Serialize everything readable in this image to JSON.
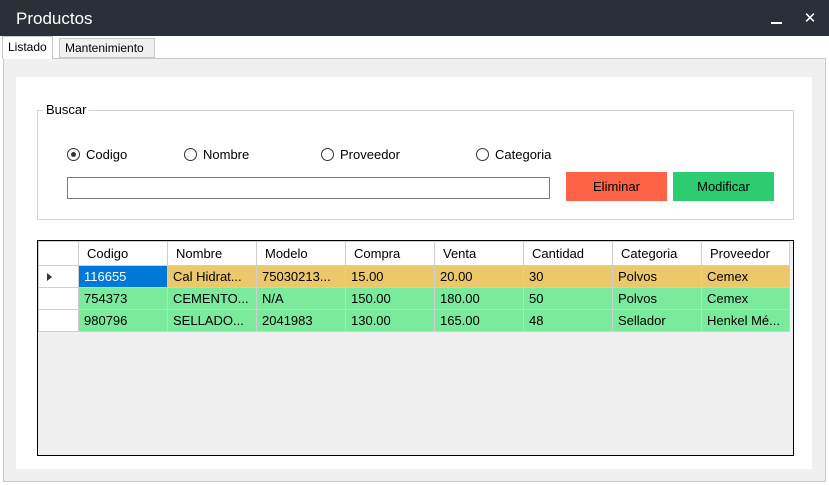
{
  "window": {
    "title": "Productos",
    "minimize_icon": "minimize-icon",
    "close_icon": "close-icon",
    "close_glyph": "✕"
  },
  "tabs": [
    {
      "label": "Listado",
      "active": true
    },
    {
      "label": "Mantenimiento",
      "active": false
    }
  ],
  "search": {
    "group_label": "Buscar",
    "options": [
      {
        "label": "Codigo",
        "checked": true
      },
      {
        "label": "Nombre",
        "checked": false
      },
      {
        "label": "Proveedor",
        "checked": false
      },
      {
        "label": "Categoria",
        "checked": false
      }
    ],
    "value": "",
    "placeholder": ""
  },
  "buttons": {
    "delete_label": "Eliminar",
    "edit_label": "Modificar"
  },
  "table": {
    "columns": [
      "Codigo",
      "Nombre",
      "Modelo",
      "Compra",
      "Venta",
      "Cantidad",
      "Categoria",
      "Proveedor"
    ],
    "rows": [
      {
        "cells": [
          "116655",
          "Cal Hidrat...",
          "75030213...",
          "15.00",
          "20.00",
          "30",
          "Polvos",
          "Cemex"
        ],
        "current": true
      },
      {
        "cells": [
          "754373",
          "CEMENTO...",
          "N/A",
          "150.00",
          "180.00",
          "50",
          "Polvos",
          "Cemex"
        ],
        "current": false
      },
      {
        "cells": [
          "980796",
          "SELLADO...",
          "2041983",
          "130.00",
          "165.00",
          "48",
          "Sellador",
          "Henkel Mé..."
        ],
        "current": false
      }
    ],
    "current_row_indicator": "row-pointer-icon"
  },
  "colors": {
    "titlebar": "#2b2f38",
    "delete_button": "#ff6347",
    "edit_button": "#2ecc71",
    "row_highlight": "#ebc86a",
    "row_normal": "#7aea9c",
    "selection": "#0078d7"
  }
}
